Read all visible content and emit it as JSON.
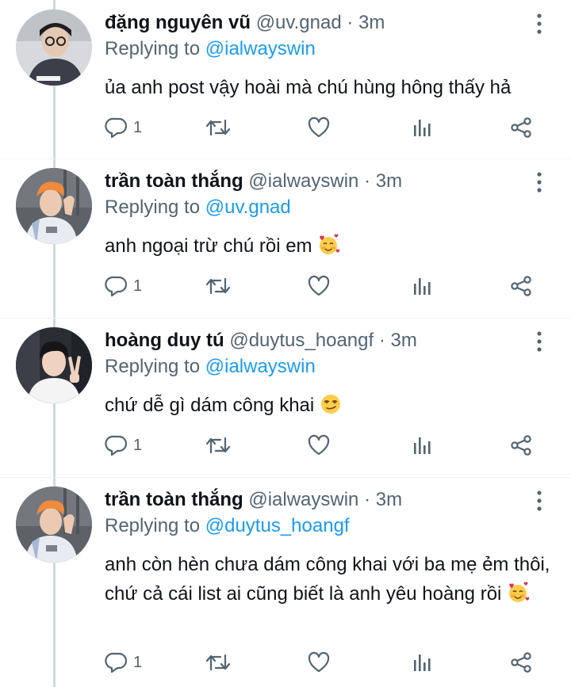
{
  "tweets": [
    {
      "name": "đặng nguyên vũ",
      "handle": "@uv.gnad",
      "separator": "·",
      "time": "3m",
      "replying_prefix": "Replying to",
      "replying_to": "@ialwayswin",
      "text": "ủa anh post vậy hoài mà chú hùng hông thấy hả",
      "emoji": "",
      "reply_count": "1",
      "avatar_icon": "person-avatar-glasses"
    },
    {
      "name": "trần toàn thắng",
      "handle": "@ialwayswin",
      "separator": "·",
      "time": "3m",
      "replying_prefix": "Replying to",
      "replying_to": "@uv.gnad",
      "text": "anh ngoại trừ chú rồi em ",
      "emoji": "smiling-face-with-hearts",
      "reply_count": "1",
      "avatar_icon": "person-avatar-orange-hair"
    },
    {
      "name": "hoàng duy tú",
      "handle": "@duytus_hoangf",
      "separator": "·",
      "time": "3m",
      "replying_prefix": "Replying to",
      "replying_to": "@ialwayswin",
      "text": "chứ dễ gì dám công khai ",
      "emoji": "smirking-face",
      "reply_count": "1",
      "avatar_icon": "person-avatar-peace-sign"
    },
    {
      "name": "trần toàn thắng",
      "handle": "@ialwayswin",
      "separator": "·",
      "time": "3m",
      "replying_prefix": "Replying to",
      "replying_to": "@duytus_hoangf",
      "text": "anh còn hèn chưa dám công khai với ba mẹ ẻm thôi, chứ cả cái list ai cũng biết là anh yêu hoàng rồi ",
      "emoji": "smiling-face-with-hearts",
      "reply_count": "1",
      "avatar_icon": "person-avatar-orange-hair"
    }
  ],
  "colors": {
    "text": "#0f1419",
    "muted": "#536471",
    "link": "#1d9bf0",
    "thread_line": "#cfd9de"
  },
  "icons": [
    "reply-icon",
    "retweet-icon",
    "like-icon",
    "views-icon",
    "share-icon",
    "more-icon"
  ]
}
